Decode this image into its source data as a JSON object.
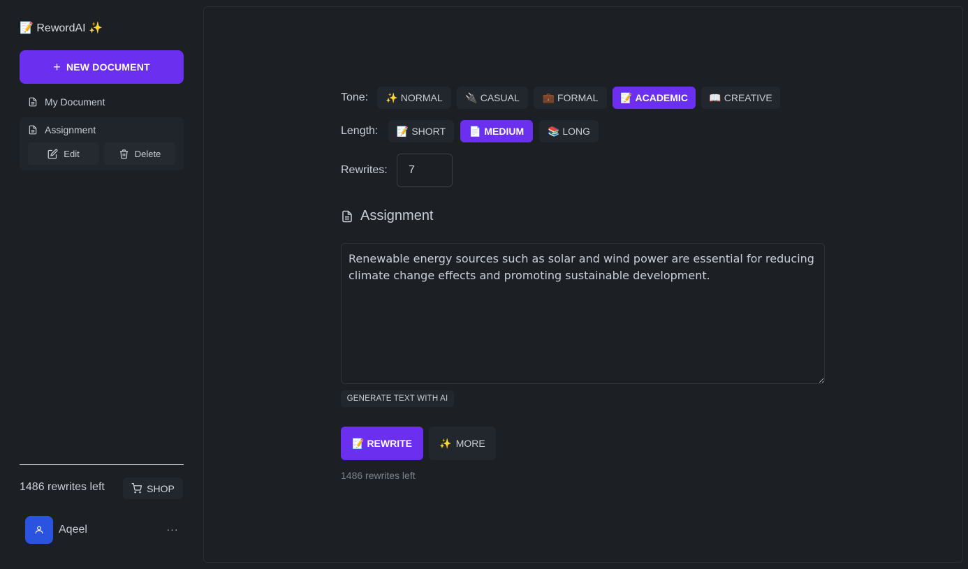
{
  "sidebar": {
    "brand": "📝 RewordAI ✨",
    "new_document_label": "NEW DOCUMENT",
    "documents": [
      {
        "label": "My Document"
      },
      {
        "label": "Assignment"
      }
    ],
    "edit_label": "Edit",
    "delete_label": "Delete",
    "rewrites_left": "1486 rewrites left",
    "shop_label": "SHOP",
    "user_name": "Aqeel",
    "more_label": "···"
  },
  "main": {
    "tone_label": "Tone:",
    "tones": [
      {
        "emoji": "✨",
        "label": "NORMAL",
        "active": false
      },
      {
        "emoji": "🔌",
        "label": "CASUAL",
        "active": false
      },
      {
        "emoji": "💼",
        "label": "FORMAL",
        "active": false
      },
      {
        "emoji": "📝",
        "label": "ACADEMIC",
        "active": true
      },
      {
        "emoji": "📖",
        "label": "CREATIVE",
        "active": false
      }
    ],
    "length_label": "Length:",
    "lengths": [
      {
        "emoji": "📝",
        "label": "SHORT",
        "active": false
      },
      {
        "emoji": "📄",
        "label": "MEDIUM",
        "active": true
      },
      {
        "emoji": "📚",
        "label": "LONG",
        "active": false
      }
    ],
    "rewrites_label": "Rewrites:",
    "rewrites_value": "7",
    "document_title": "Assignment",
    "editor_text": "Renewable energy sources such as solar and wind power are essential for reducing climate change effects and promoting sustainable development.",
    "generate_label": "GENERATE TEXT WITH AI",
    "rewrite_emoji": "📝",
    "rewrite_label": "REWRITE",
    "more_emoji": "✨",
    "more_label": "MORE",
    "rewrites_note": "1486 rewrites left"
  },
  "colors": {
    "accent": "#6b2ff0",
    "background": "#1c2025",
    "avatar": "#2a54e0"
  }
}
